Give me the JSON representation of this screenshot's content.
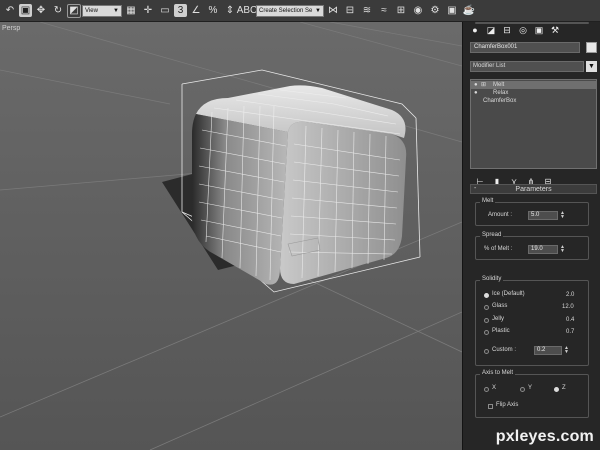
{
  "toolbar": {
    "view_dropdown": "View",
    "selection_set_dropdown": "Create Selection Se",
    "snap_value": "3"
  },
  "viewport": {
    "label": "Persp",
    "object_label": "ChamferBox"
  },
  "command_panel": {
    "object_name": "ChamferBox001",
    "modifier_list": "Modifier List",
    "stack": [
      {
        "label": "Melt",
        "selected": true
      },
      {
        "label": "Relax",
        "selected": false
      },
      {
        "label": "ChamferBox",
        "selected": false
      }
    ],
    "rollout_title": "Parameters",
    "rollout_minus": "-",
    "melt": {
      "group_title": "Melt",
      "amount_label": "Amount :",
      "amount_value": "5.0"
    },
    "spread": {
      "group_title": "Spread",
      "percent_label": "% of Melt :",
      "percent_value": "19.0"
    },
    "solidity": {
      "group_title": "Solidity",
      "options": [
        {
          "label": "Ice (Default)",
          "value": "2.0",
          "selected": true
        },
        {
          "label": "Glass",
          "value": "12.0",
          "selected": false
        },
        {
          "label": "Jelly",
          "value": "0.4",
          "selected": false
        },
        {
          "label": "Plastic",
          "value": "0.7",
          "selected": false
        }
      ],
      "custom_label": "Custom :",
      "custom_value": "0.2"
    },
    "axis": {
      "group_title": "Axis to Melt",
      "x_label": "X",
      "y_label": "Y",
      "z_label": "Z",
      "selected": "Z",
      "flip_label": "Flip Axis"
    }
  },
  "watermark": "pxleyes.com",
  "colors": {
    "viewport_bg": "#5f5f5f",
    "panel_bg": "#262626",
    "toolbar_bg": "#3b3b3b"
  }
}
